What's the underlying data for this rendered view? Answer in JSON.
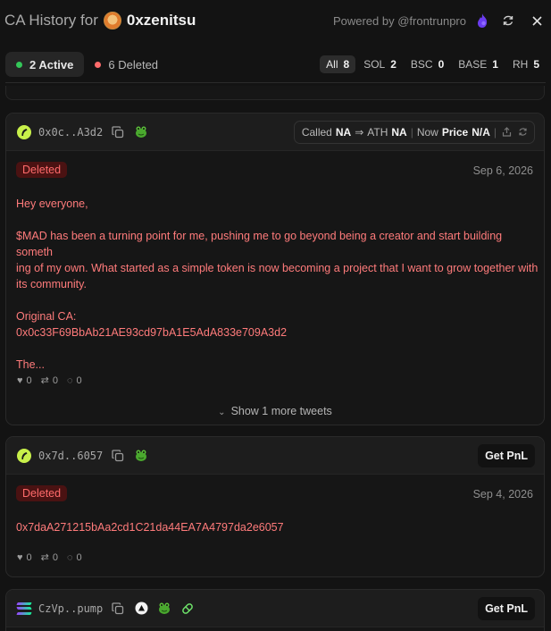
{
  "header": {
    "title_prefix": "CA History for",
    "username": "0xzenitsu",
    "powered_by": "Powered by @frontrunpro",
    "icons": {
      "avatar": "user-avatar",
      "brand": "flame-icon",
      "refresh": "refresh-icon",
      "close": "close-icon"
    }
  },
  "filters": {
    "active_label": "2 Active",
    "deleted_label": "6 Deleted",
    "active_color": "#34c759",
    "deleted_color": "#ff6b6b",
    "chains": [
      {
        "label": "All",
        "count": "8"
      },
      {
        "label": "SOL",
        "count": "2"
      },
      {
        "label": "BSC",
        "count": "0"
      },
      {
        "label": "BASE",
        "count": "1"
      },
      {
        "label": "RH",
        "count": "5"
      }
    ]
  },
  "cards": [
    {
      "address_short": "0x0c..A3d2",
      "stats": {
        "called_label": "Called",
        "called_value": "NA",
        "arrow": "⇒",
        "ath_label": "ATH",
        "ath_value": "NA",
        "sep": "|",
        "now_label": "Now",
        "price_label": "Price",
        "price_value": "N/A"
      },
      "status": "Deleted",
      "date": "Sep 6, 2026",
      "tweet_lines": [
        "Hey everyone,",
        "",
        "$MAD has been a turning point for me, pushing me to go beyond being a creator and start building someth",
        "ing of my own. What started as a simple token is now becoming a project that I want to grow together with",
        "its community.",
        "",
        "Original CA:",
        "0x0c33F69BbAb21AE93cd97bA1E5AdA833e709A3d2",
        "",
        "The..."
      ],
      "likes": "0",
      "retweets": "0",
      "replies": "0",
      "more_label": "Show 1 more tweets"
    },
    {
      "address_short": "0x7d..6057",
      "pnl_label": "Get PnL",
      "status": "Deleted",
      "date": "Sep 4, 2026",
      "tweet_lines": [
        "0x7daA271215bAa2cd1C21da44EA7A4797da2e6057"
      ],
      "likes": "0",
      "retweets": "0",
      "replies": "0"
    },
    {
      "address_short": "CzVp..pump",
      "pnl_label": "Get PnL"
    }
  ]
}
